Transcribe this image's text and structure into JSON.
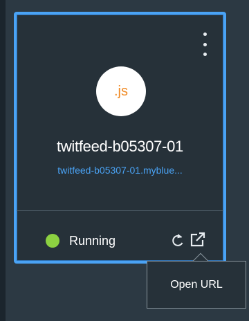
{
  "app": {
    "runtime_badge": ".js",
    "name": "twitfeed-b05307-01",
    "url": "twitfeed-b05307-01.myblue...",
    "status": "Running"
  },
  "actions": {
    "tooltip": "Open URL"
  },
  "icons": {
    "menu": "overflow-menu-icon",
    "restart": "restart-icon",
    "open_url": "launch-icon",
    "status": "status-dot-icon"
  },
  "colors": {
    "background": "#2c3943",
    "card": "#263139",
    "selection_border": "#4aa3f5",
    "link": "#4aa3f5",
    "runtime_accent": "#f08a24",
    "status_running": "#8cd141"
  }
}
